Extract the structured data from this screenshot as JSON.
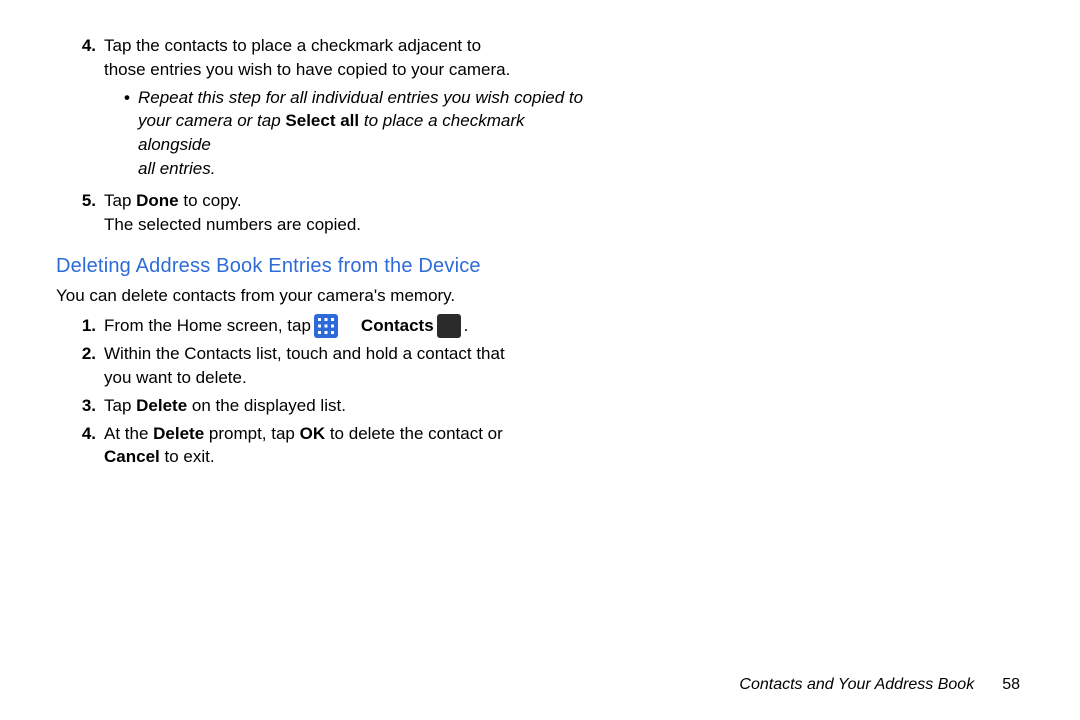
{
  "list1": {
    "item4": {
      "num": "4.",
      "text_a": "Tap the contacts to place a checkmark adjacent to",
      "text_b": "those entries you wish to have copied to your camera.",
      "bullet": {
        "line1": "Repeat this step for all individual entries you wish copied to",
        "line2_a": "your camera or tap ",
        "line2_bold": "Select all",
        "line2_b": " to place a checkmark alongside",
        "line3": "all entries."
      }
    },
    "item5": {
      "num": "5.",
      "text_a1": "Tap ",
      "text_bold": "Done",
      "text_a2": " to copy.",
      "text_b": "The selected numbers are copied."
    }
  },
  "heading": "Deleting Address Book Entries from the Device",
  "intro": "You can delete contacts from your camera's memory.",
  "list2": {
    "item1": {
      "num": "1.",
      "text_a": "From the Home screen, tap ",
      "contacts_label": "Contacts",
      "period": "."
    },
    "item2": {
      "num": "2.",
      "line1": "Within the Contacts list, touch and hold a contact that",
      "line2": "you want to delete."
    },
    "item3": {
      "num": "3.",
      "text_a": "Tap ",
      "bold": "Delete",
      "text_b": " on the displayed list."
    },
    "item4": {
      "num": "4.",
      "text_a": "At the ",
      "bold1": "Delete",
      "text_b": " prompt, tap ",
      "bold2": "OK",
      "text_c": " to delete the contact or",
      "line2_bold": "Cancel",
      "line2_rest": " to exit."
    }
  },
  "footer": {
    "section": "Contacts and Your Address Book",
    "page": "58"
  }
}
